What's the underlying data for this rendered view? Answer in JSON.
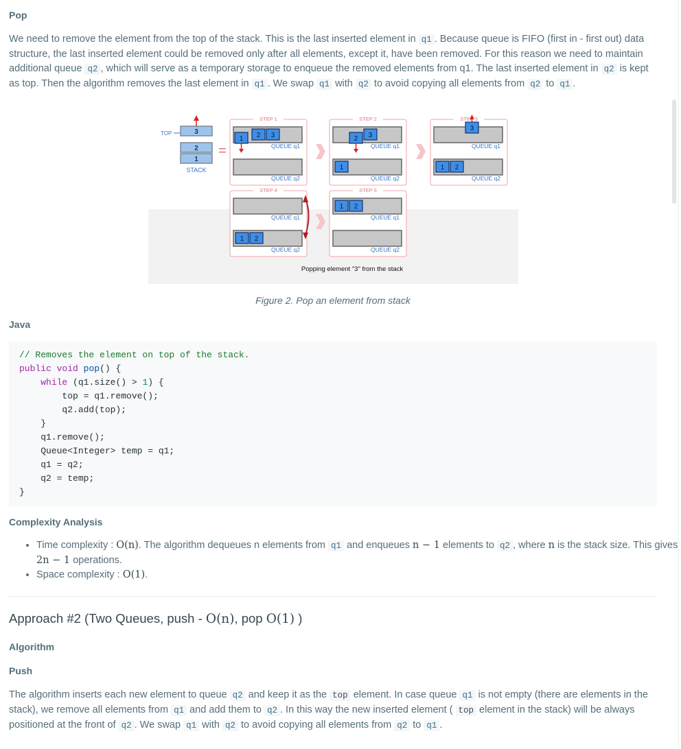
{
  "pop_heading": "Pop",
  "pop_para": [
    {
      "t": "We need to remove the element from the top of the stack. This is the last inserted element in "
    },
    {
      "c": "q1"
    },
    {
      "t": ". Because queue is FIFO (first in - first out) data structure, the last inserted element could be removed only after all elements, except it, have been removed. For this reason we need to maintain additional queue "
    },
    {
      "c": "q2"
    },
    {
      "t": ", which will serve as a temporary storage to enqueue the removed elements from q1. The last inserted element in "
    },
    {
      "c": "q2"
    },
    {
      "t": " is kept as top. Then the algorithm removes the last element in "
    },
    {
      "c": "q1"
    },
    {
      "t": ". We swap "
    },
    {
      "c": "q1"
    },
    {
      "t": " with "
    },
    {
      "c": "q2"
    },
    {
      "t": " to avoid copying all elements from "
    },
    {
      "c": "q2"
    },
    {
      "t": " to "
    },
    {
      "c": "q1"
    },
    {
      "t": "."
    }
  ],
  "figure": {
    "stack": {
      "top_label": "TOP",
      "items": [
        "3",
        "2",
        "1"
      ],
      "label": "STACK",
      "equals": "="
    },
    "steps": [
      {
        "name": "STEP 1",
        "q1": [
          "2",
          "3"
        ],
        "floating": "1",
        "q2": [],
        "q1_label": "QUEUE q1",
        "q2_label": "QUEUE q2"
      },
      {
        "name": "STEP 2",
        "q1": [
          "3"
        ],
        "floating": "2",
        "q2": [
          "1"
        ],
        "q1_label": "QUEUE q1",
        "q2_label": "QUEUE q2"
      },
      {
        "name": "STEP 3",
        "q1": [],
        "floating": "3",
        "q2": [
          "1",
          "2"
        ],
        "q1_label": "QUEUE q1",
        "q2_label": "QUEUE q2"
      },
      {
        "name": "STEP 4",
        "q1": [],
        "q2": [
          "1",
          "2"
        ],
        "q1_label": "QUEUE q1",
        "q2_label": "QUEUE q2"
      },
      {
        "name": "STEP 5",
        "q1": [
          "1",
          "2"
        ],
        "q2": [],
        "q1_label": "QUEUE q1",
        "q2_label": "QUEUE q2"
      }
    ],
    "inner_caption": "Popping element \"3\" from the stack"
  },
  "figure_caption": "Figure 2. Pop an element from stack",
  "java_heading": "Java",
  "code_lines": [
    [
      {
        "cls": "cm",
        "t": "// Removes the element on top of the stack."
      }
    ],
    [
      {
        "cls": "kw",
        "t": "public"
      },
      {
        "t": " "
      },
      {
        "cls": "kw",
        "t": "void"
      },
      {
        "t": " "
      },
      {
        "cls": "fn",
        "t": "pop"
      },
      {
        "t": "() {"
      }
    ],
    [
      {
        "t": "    "
      },
      {
        "cls": "kw",
        "t": "while"
      },
      {
        "t": " (q1.size() > "
      },
      {
        "cls": "num",
        "t": "1"
      },
      {
        "t": ") {"
      }
    ],
    [
      {
        "t": "        top = q1.remove();"
      }
    ],
    [
      {
        "t": "        q2.add(top);"
      }
    ],
    [
      {
        "t": "    }"
      }
    ],
    [
      {
        "t": "    q1.remove();"
      }
    ],
    [
      {
        "t": "    Queue<Integer> temp = q1;"
      }
    ],
    [
      {
        "t": "    q1 = q2;"
      }
    ],
    [
      {
        "t": "    q2 = temp;"
      }
    ],
    [
      {
        "t": "}"
      }
    ]
  ],
  "complexity_heading": "Complexity Analysis",
  "complexity_items": [
    [
      {
        "t": "Time complexity : "
      },
      {
        "m": "O(n)"
      },
      {
        "t": ". The algorithm dequeues n elements from "
      },
      {
        "c": "q1"
      },
      {
        "t": " and enqueues "
      },
      {
        "m": "n − 1"
      },
      {
        "t": " elements to "
      },
      {
        "c": "q2"
      },
      {
        "t": ", where "
      },
      {
        "m": "n"
      },
      {
        "t": " is the stack size. This gives "
      },
      {
        "m": "2n − 1"
      },
      {
        "t": " operations."
      }
    ],
    [
      {
        "t": "Space complexity : "
      },
      {
        "m": "O(1)"
      },
      {
        "t": "."
      }
    ]
  ],
  "approach_title": [
    {
      "t": "Approach #2 (Two Queues, push - "
    },
    {
      "m": "O(n)"
    },
    {
      "t": ", pop "
    },
    {
      "m": "O(1)"
    },
    {
      "t": " )"
    }
  ],
  "algorithm_heading": "Algorithm",
  "push_heading": "Push",
  "push_para": [
    {
      "t": "The algorithm inserts each new element to queue "
    },
    {
      "c": "q2"
    },
    {
      "t": " and keep it as the "
    },
    {
      "c2": "top"
    },
    {
      "t": " element. In case queue "
    },
    {
      "c": "q1"
    },
    {
      "t": " is not empty (there are elements in the stack), we remove all elements from "
    },
    {
      "c": "q1"
    },
    {
      "t": " and add them to "
    },
    {
      "c": "q2"
    },
    {
      "t": ". In this way the new inserted element ( "
    },
    {
      "c2": "top"
    },
    {
      "t": " element in the stack) will be always positioned at the front of "
    },
    {
      "c": "q2"
    },
    {
      "t": ". We swap "
    },
    {
      "c": "q1"
    },
    {
      "t": " with "
    },
    {
      "c": "q2"
    },
    {
      "t": " to avoid copying all elements from "
    },
    {
      "c": "q2"
    },
    {
      "t": " to "
    },
    {
      "c": "q1"
    },
    {
      "t": "."
    }
  ]
}
